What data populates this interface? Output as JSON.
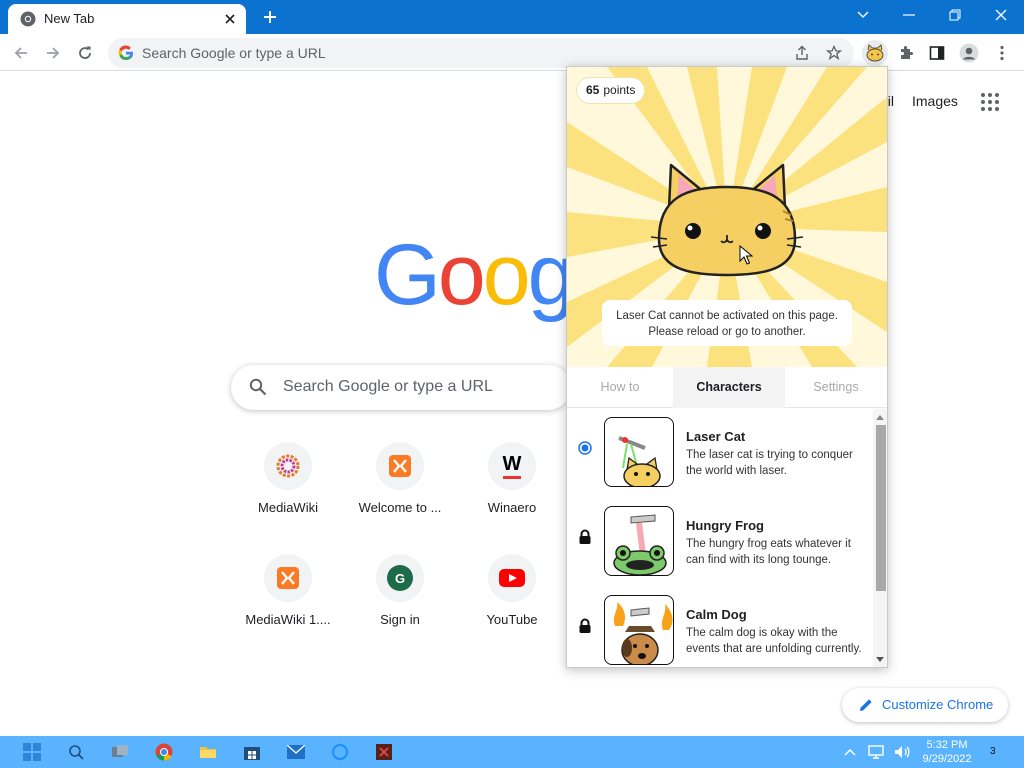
{
  "browser": {
    "tab_title": "New Tab",
    "omnibox_placeholder": "Search Google or type a URL"
  },
  "ntp": {
    "header_links": [
      "ail",
      "Images"
    ],
    "logo_letters": [
      "G",
      "o",
      "o",
      "g"
    ],
    "search_placeholder": "Search Google or type a URL",
    "shortcuts": [
      {
        "label": "MediaWiki",
        "icon": "mediawiki-icon"
      },
      {
        "label": "Welcome to ...",
        "icon": "xampp-icon"
      },
      {
        "label": "Winaero",
        "icon": "winaero-icon",
        "glyph": "W"
      },
      {
        "label": "MediaWiki 1....",
        "icon": "xampp-icon"
      },
      {
        "label": "Sign in",
        "icon": "sign-in-icon",
        "glyph": "G"
      },
      {
        "label": "YouTube",
        "icon": "youtube-icon"
      }
    ],
    "customize_label": "Customize Chrome"
  },
  "popup": {
    "points_value": "65",
    "points_label": "points",
    "notice_line1": "Laser Cat cannot be activated on this page.",
    "notice_line2": "Please reload or go to another.",
    "tabs": [
      "How to",
      "Characters",
      "Settings"
    ],
    "active_tab": "Characters",
    "characters": [
      {
        "name": "Laser Cat",
        "desc": "The laser cat is trying to conquer the world with laser.",
        "status": "selected"
      },
      {
        "name": "Hungry Frog",
        "desc": "The hungry frog eats whatever it can find with its long tounge.",
        "status": "locked"
      },
      {
        "name": "Calm Dog",
        "desc": "The calm dog is okay with the events that are unfolding currently.",
        "status": "locked"
      }
    ]
  },
  "taskbar": {
    "time": "5:32 PM",
    "date": "9/29/2022",
    "notification_count": "3"
  },
  "colors": {
    "titlebar": "#0b73cf",
    "taskbar": "#5ab3ff",
    "accent": "#1a73e8",
    "hero_yellow": "#fbe27f"
  }
}
